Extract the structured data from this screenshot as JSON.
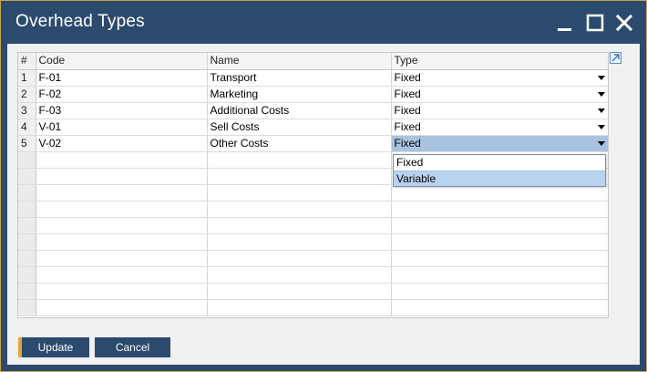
{
  "window": {
    "title": "Overhead Types"
  },
  "grid": {
    "columns": [
      "#",
      "Code",
      "Name",
      "Type"
    ],
    "rows": [
      {
        "num": "1",
        "code": "F-01",
        "name": "Transport",
        "type": "Fixed"
      },
      {
        "num": "2",
        "code": "F-02",
        "name": "Marketing",
        "type": "Fixed"
      },
      {
        "num": "3",
        "code": "F-03",
        "name": "Additional Costs",
        "type": "Fixed"
      },
      {
        "num": "4",
        "code": "V-01",
        "name": "Sell Costs",
        "type": "Fixed"
      },
      {
        "num": "5",
        "code": "V-02",
        "name": "Other Costs",
        "type": "Fixed"
      }
    ]
  },
  "type_dropdown": {
    "options": [
      "Fixed",
      "Variable"
    ],
    "highlighted": "Variable"
  },
  "buttons": {
    "update": "Update",
    "cancel": "Cancel"
  },
  "colors": {
    "titlebar": "#2c4a6e",
    "button": "#2c4a6e",
    "button_accent": "#e6a23a",
    "active_cell": "#a8c3e0",
    "dropdown_highlight": "#b8d3ef"
  }
}
